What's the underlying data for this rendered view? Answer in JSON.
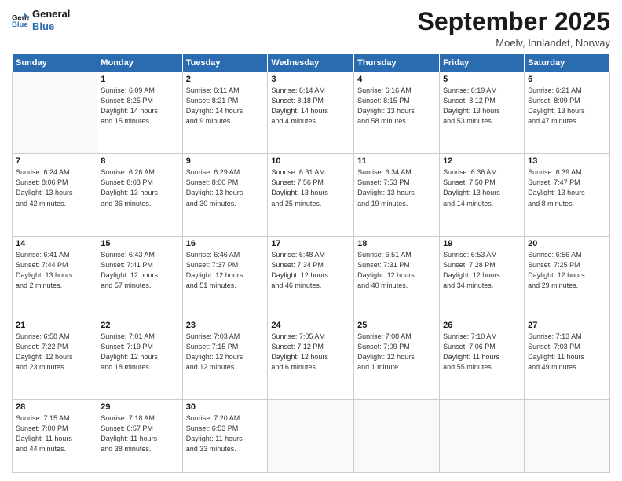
{
  "logo": {
    "line1": "General",
    "line2": "Blue"
  },
  "title": "September 2025",
  "subtitle": "Moelv, Innlandet, Norway",
  "days_header": [
    "Sunday",
    "Monday",
    "Tuesday",
    "Wednesday",
    "Thursday",
    "Friday",
    "Saturday"
  ],
  "weeks": [
    [
      {
        "day": "",
        "info": ""
      },
      {
        "day": "1",
        "info": "Sunrise: 6:09 AM\nSunset: 8:25 PM\nDaylight: 14 hours\nand 15 minutes."
      },
      {
        "day": "2",
        "info": "Sunrise: 6:11 AM\nSunset: 8:21 PM\nDaylight: 14 hours\nand 9 minutes."
      },
      {
        "day": "3",
        "info": "Sunrise: 6:14 AM\nSunset: 8:18 PM\nDaylight: 14 hours\nand 4 minutes."
      },
      {
        "day": "4",
        "info": "Sunrise: 6:16 AM\nSunset: 8:15 PM\nDaylight: 13 hours\nand 58 minutes."
      },
      {
        "day": "5",
        "info": "Sunrise: 6:19 AM\nSunset: 8:12 PM\nDaylight: 13 hours\nand 53 minutes."
      },
      {
        "day": "6",
        "info": "Sunrise: 6:21 AM\nSunset: 8:09 PM\nDaylight: 13 hours\nand 47 minutes."
      }
    ],
    [
      {
        "day": "7",
        "info": "Sunrise: 6:24 AM\nSunset: 8:06 PM\nDaylight: 13 hours\nand 42 minutes."
      },
      {
        "day": "8",
        "info": "Sunrise: 6:26 AM\nSunset: 8:03 PM\nDaylight: 13 hours\nand 36 minutes."
      },
      {
        "day": "9",
        "info": "Sunrise: 6:29 AM\nSunset: 8:00 PM\nDaylight: 13 hours\nand 30 minutes."
      },
      {
        "day": "10",
        "info": "Sunrise: 6:31 AM\nSunset: 7:56 PM\nDaylight: 13 hours\nand 25 minutes."
      },
      {
        "day": "11",
        "info": "Sunrise: 6:34 AM\nSunset: 7:53 PM\nDaylight: 13 hours\nand 19 minutes."
      },
      {
        "day": "12",
        "info": "Sunrise: 6:36 AM\nSunset: 7:50 PM\nDaylight: 13 hours\nand 14 minutes."
      },
      {
        "day": "13",
        "info": "Sunrise: 6:39 AM\nSunset: 7:47 PM\nDaylight: 13 hours\nand 8 minutes."
      }
    ],
    [
      {
        "day": "14",
        "info": "Sunrise: 6:41 AM\nSunset: 7:44 PM\nDaylight: 13 hours\nand 2 minutes."
      },
      {
        "day": "15",
        "info": "Sunrise: 6:43 AM\nSunset: 7:41 PM\nDaylight: 12 hours\nand 57 minutes."
      },
      {
        "day": "16",
        "info": "Sunrise: 6:46 AM\nSunset: 7:37 PM\nDaylight: 12 hours\nand 51 minutes."
      },
      {
        "day": "17",
        "info": "Sunrise: 6:48 AM\nSunset: 7:34 PM\nDaylight: 12 hours\nand 46 minutes."
      },
      {
        "day": "18",
        "info": "Sunrise: 6:51 AM\nSunset: 7:31 PM\nDaylight: 12 hours\nand 40 minutes."
      },
      {
        "day": "19",
        "info": "Sunrise: 6:53 AM\nSunset: 7:28 PM\nDaylight: 12 hours\nand 34 minutes."
      },
      {
        "day": "20",
        "info": "Sunrise: 6:56 AM\nSunset: 7:25 PM\nDaylight: 12 hours\nand 29 minutes."
      }
    ],
    [
      {
        "day": "21",
        "info": "Sunrise: 6:58 AM\nSunset: 7:22 PM\nDaylight: 12 hours\nand 23 minutes."
      },
      {
        "day": "22",
        "info": "Sunrise: 7:01 AM\nSunset: 7:19 PM\nDaylight: 12 hours\nand 18 minutes."
      },
      {
        "day": "23",
        "info": "Sunrise: 7:03 AM\nSunset: 7:15 PM\nDaylight: 12 hours\nand 12 minutes."
      },
      {
        "day": "24",
        "info": "Sunrise: 7:05 AM\nSunset: 7:12 PM\nDaylight: 12 hours\nand 6 minutes."
      },
      {
        "day": "25",
        "info": "Sunrise: 7:08 AM\nSunset: 7:09 PM\nDaylight: 12 hours\nand 1 minute."
      },
      {
        "day": "26",
        "info": "Sunrise: 7:10 AM\nSunset: 7:06 PM\nDaylight: 11 hours\nand 55 minutes."
      },
      {
        "day": "27",
        "info": "Sunrise: 7:13 AM\nSunset: 7:03 PM\nDaylight: 11 hours\nand 49 minutes."
      }
    ],
    [
      {
        "day": "28",
        "info": "Sunrise: 7:15 AM\nSunset: 7:00 PM\nDaylight: 11 hours\nand 44 minutes."
      },
      {
        "day": "29",
        "info": "Sunrise: 7:18 AM\nSunset: 6:57 PM\nDaylight: 11 hours\nand 38 minutes."
      },
      {
        "day": "30",
        "info": "Sunrise: 7:20 AM\nSunset: 6:53 PM\nDaylight: 11 hours\nand 33 minutes."
      },
      {
        "day": "",
        "info": ""
      },
      {
        "day": "",
        "info": ""
      },
      {
        "day": "",
        "info": ""
      },
      {
        "day": "",
        "info": ""
      }
    ]
  ]
}
